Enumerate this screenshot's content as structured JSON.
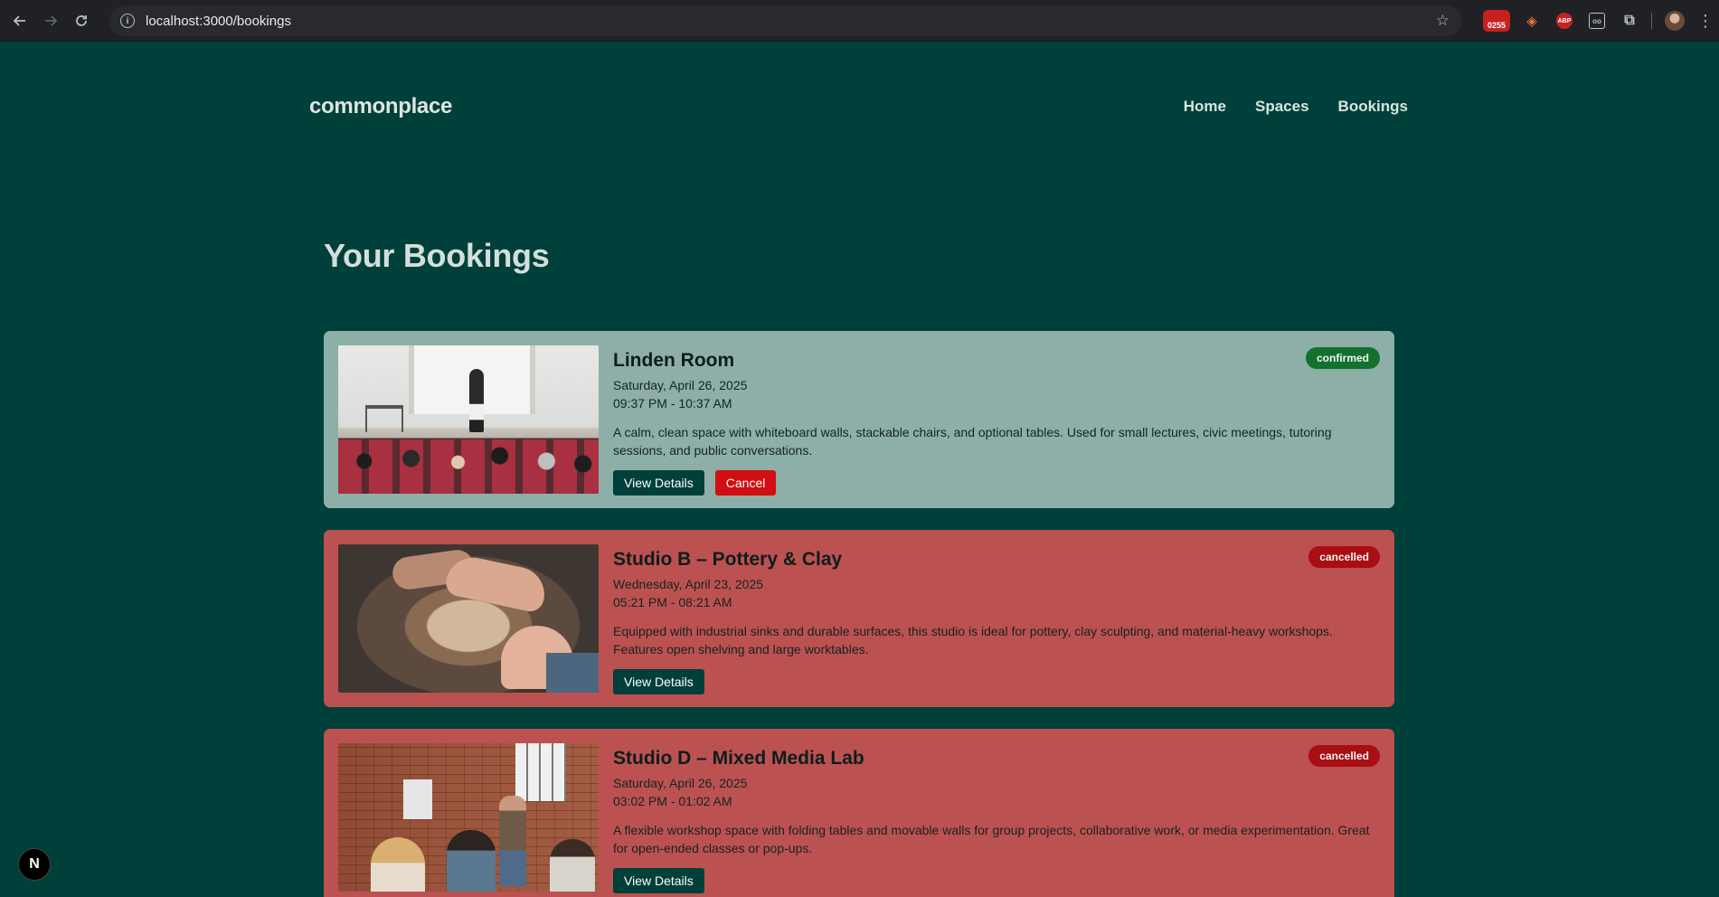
{
  "browser": {
    "url": "localhost:3000/bookings",
    "extension_badge": "0255",
    "abp_label": "ABP",
    "box_ext_label": "oo"
  },
  "header": {
    "logo": "commonplace",
    "nav": [
      "Home",
      "Spaces",
      "Bookings"
    ]
  },
  "page": {
    "title": "Your Bookings"
  },
  "bookings": [
    {
      "name": "Linden Room",
      "date": "Saturday, April 26, 2025",
      "time": "09:37 PM - 10:37 AM",
      "description": "A calm, clean space with whiteboard walls, stackable chairs, and optional tables. Used for small lectures, civic meetings, tutoring sessions, and public conversations.",
      "status": "confirmed",
      "view_label": "View Details",
      "cancel_label": "Cancel"
    },
    {
      "name": "Studio B – Pottery & Clay",
      "date": "Wednesday, April 23, 2025",
      "time": "05:21 PM - 08:21 AM",
      "description": "Equipped with industrial sinks and durable surfaces, this studio is ideal for pottery, clay sculpting, and material-heavy workshops. Features open shelving and large worktables.",
      "status": "cancelled",
      "view_label": "View Details"
    },
    {
      "name": "Studio D – Mixed Media Lab",
      "date": "Saturday, April 26, 2025",
      "time": "03:02 PM - 01:02 AM",
      "description": "A flexible workshop space with folding tables and movable walls for group projects, collaborative work, or media experimentation. Great for open-ended classes or pop-ups.",
      "status": "cancelled",
      "view_label": "View Details"
    }
  ],
  "dev_indicator": "N",
  "colors": {
    "page_bg": "#00403a",
    "confirmed_card": "#8eafa8",
    "cancelled_card": "#bc5151",
    "confirmed_badge": "#13702f",
    "cancelled_badge": "#a80e12",
    "cancel_button": "#d10e12"
  }
}
